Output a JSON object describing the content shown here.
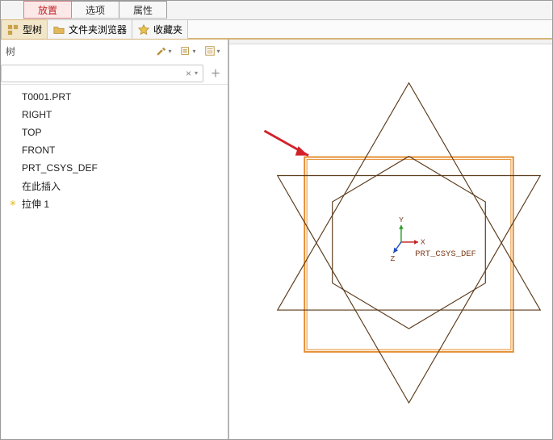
{
  "ribbon": {
    "tabs": [
      {
        "label": "放置",
        "active": true
      },
      {
        "label": "选项",
        "active": false
      },
      {
        "label": "属性",
        "active": false
      }
    ]
  },
  "subtabs": {
    "tree_tab_label": "型树",
    "folder_browser_label": "文件夹浏览器",
    "favorites_label": "收藏夹"
  },
  "tree": {
    "header_label": "树",
    "search_value": "",
    "items": [
      {
        "label": "T0001.PRT",
        "kind": "part"
      },
      {
        "label": "RIGHT",
        "kind": "plane"
      },
      {
        "label": "TOP",
        "kind": "plane"
      },
      {
        "label": "FRONT",
        "kind": "plane"
      },
      {
        "label": "PRT_CSYS_DEF",
        "kind": "csys"
      },
      {
        "label": "在此插入",
        "kind": "insert"
      },
      {
        "label": "拉伸 1",
        "kind": "feature-new"
      }
    ]
  },
  "viewport": {
    "csys_label": "PRT_CSYS_DEF",
    "axes": {
      "x": "X",
      "y": "Y",
      "z": "Z"
    },
    "colors": {
      "square_outline": "#e58a2a",
      "hexagon": "#5a3a1a",
      "triangles": "#5a3a1a",
      "arrow": "#d4202a",
      "axis_x": "#c02020",
      "axis_y": "#2a9a2a",
      "axis_z": "#2050c0"
    }
  }
}
